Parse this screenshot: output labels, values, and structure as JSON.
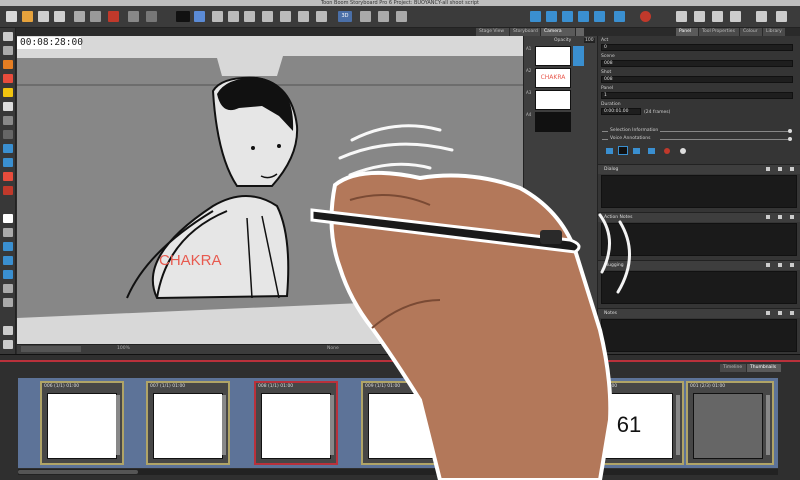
{
  "app": {
    "title": "Toon Boom Storyboard Pro 6 Project: BUOYANCY-all shoot script"
  },
  "toolbar": {
    "icons": [
      "new-icon",
      "open-icon",
      "save-icon",
      "scissors-icon",
      "gear-icon",
      "undo-icon",
      "grid-icon",
      "transform-icon",
      "play-icon",
      "loop-icon",
      "volume-icon",
      "camera-icon",
      "3d-icon"
    ],
    "mode_label": "3D"
  },
  "stage": {
    "tabs": [
      "Stage View",
      "Storyboard",
      "Camera View"
    ],
    "active_tab": "Camera View",
    "timecode": "00:08:28:00",
    "zoom": "100%",
    "status_right": "None",
    "drawing_caption": "CHAKRA"
  },
  "thumbnails": {
    "header_left": "Opacity",
    "header_right": "100",
    "rows": [
      {
        "num": "A1",
        "label": ""
      },
      {
        "num": "A2",
        "label": "CHAKRA"
      },
      {
        "num": "A3",
        "label": ""
      },
      {
        "num": "A4",
        "label": ""
      }
    ]
  },
  "right_panel": {
    "tabs": [
      "Panel",
      "Tool Properties",
      "Colour",
      "Library"
    ],
    "active_tab": "Panel",
    "fields": [
      {
        "label": "Act",
        "value": "0"
      },
      {
        "label": "Scene",
        "value": "008"
      },
      {
        "label": "Shot",
        "value": "008"
      },
      {
        "label": "Panel",
        "value": "1"
      }
    ],
    "duration_label": "Duration",
    "duration_value": "0:00:01.00",
    "duration_frames": "(24 frames)",
    "selection_information": "Selection Information",
    "voice_annotations": "Voice Annotations",
    "sections": [
      "Dialog",
      "Action Notes",
      "Slugging",
      "Notes"
    ]
  },
  "bottom": {
    "tabs": [
      "Timeline",
      "Thumbnails"
    ],
    "active_tab": "Thumbnails",
    "panels": [
      {
        "header": "006 (1/1) 01:00",
        "selected": false,
        "text": ""
      },
      {
        "header": "007 (1/1) 01:00",
        "selected": false,
        "text": ""
      },
      {
        "header": "008 (1/1) 01:00",
        "selected": true,
        "text": ""
      },
      {
        "header": "009 (1/1) 01:00",
        "selected": false,
        "text": ""
      },
      {
        "header": "001 (1/1) 01:00",
        "selected": false,
        "text": "61"
      },
      {
        "header": "001 (2/3) 01:00",
        "selected": false,
        "text": ""
      }
    ]
  },
  "colors": {
    "accent_blue": "#3a8fd0",
    "selection_red": "#b9313b",
    "panel_border": "#b0a467",
    "strip_blue": "#5d7398",
    "olive": "#807f35"
  }
}
